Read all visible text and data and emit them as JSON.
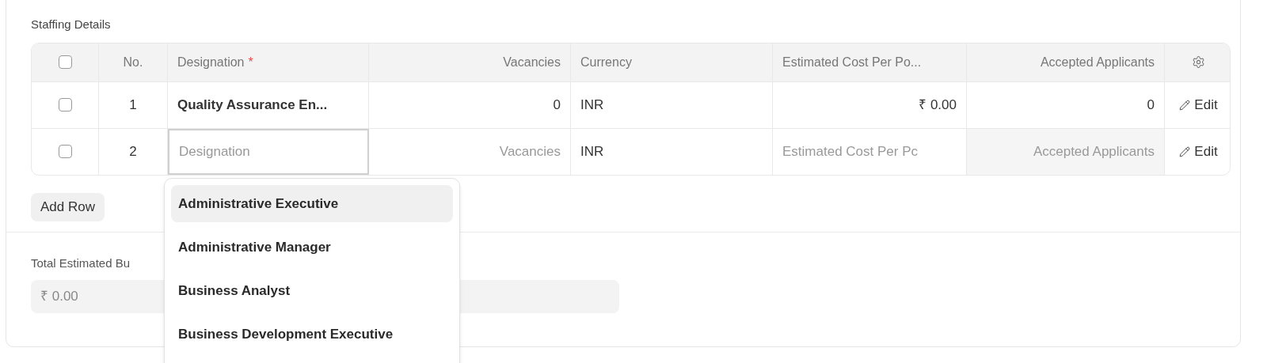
{
  "section_title": "Staffing Details",
  "table": {
    "columns": [
      {
        "label": "No."
      },
      {
        "label": "Designation",
        "required_mark": "*"
      },
      {
        "label": "Vacancies"
      },
      {
        "label": "Currency"
      },
      {
        "label": "Estimated Cost Per Po..."
      },
      {
        "label": "Accepted Applicants"
      }
    ],
    "header_checked": false,
    "rows": [
      {
        "checked": false,
        "no": "1",
        "kind": "static",
        "designation": "Quality Assurance En...",
        "vacancies": "0",
        "currency": "INR",
        "cost": "₹ 0.00",
        "accepted": "0",
        "edit": "Edit"
      },
      {
        "checked": false,
        "no": "2",
        "kind": "editing",
        "designation_placeholder": "Designation",
        "vacancies_placeholder": "Vacancies",
        "currency": "INR",
        "cost_placeholder": "Estimated Cost Per Pc",
        "accepted_placeholder": "Accepted Applicants",
        "edit": "Edit"
      }
    ]
  },
  "add_row": "Add Row",
  "total": {
    "label": "Total Estimated Bu",
    "value": "₹ 0.00"
  },
  "dropdown": {
    "items": [
      {
        "label": "Administrative Executive",
        "selected": true
      },
      {
        "label": "Administrative Manager",
        "selected": false
      },
      {
        "label": "Business Analyst",
        "selected": false
      },
      {
        "label": "Business Development Executive",
        "selected": false
      }
    ]
  }
}
